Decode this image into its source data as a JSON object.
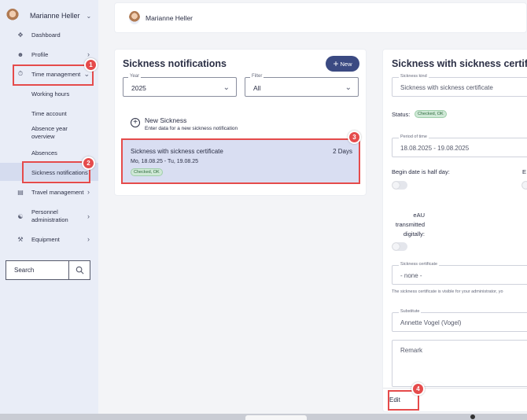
{
  "user": {
    "name": "Marianne Heller"
  },
  "sidebar": {
    "items": [
      {
        "label": "Dashboard",
        "icon": "dashboard-icon"
      },
      {
        "label": "Profile",
        "icon": "person-icon"
      },
      {
        "label": "Time management",
        "icon": "stopwatch-icon"
      },
      {
        "label": "Travel management",
        "icon": "briefcase-icon"
      },
      {
        "label": "Personnel administration",
        "icon": "people-icon"
      },
      {
        "label": "Equipment",
        "icon": "tools-icon"
      }
    ],
    "time_management_sub": [
      "Working hours",
      "Time account",
      "Absence year overview",
      "Absences",
      "Sickness notifications"
    ],
    "search_label": "Search"
  },
  "list_panel": {
    "title": "Sickness notifications",
    "new_button": "New",
    "year": {
      "label": "Year",
      "value": "2025"
    },
    "filter": {
      "label": "Filter",
      "value": "All"
    },
    "new_sickness": {
      "title": "New Sickness",
      "subtitle": "Enter data for a new sickness notification"
    },
    "entries": [
      {
        "title": "Sickness with sickness certificate",
        "duration": "2 Days",
        "dates": "Mo, 18.08.25 - Tu, 19.08.25",
        "status": "Checked, OK"
      }
    ]
  },
  "detail_panel": {
    "title": "Sickness with sickness certificat",
    "kind": {
      "label": "Sickness kind",
      "value": "Sickness with sickness certificate"
    },
    "status_label": "Status:",
    "status_value": "Checked, OK",
    "period": {
      "label": "Period of time",
      "value": "18.08.2025 - 19.08.2025"
    },
    "begin_half_day": "Begin date is half day:",
    "end_half_day_cut": "E",
    "eau_label": "eAU transmitted digitally:",
    "certificate": {
      "label": "Sickness certificate",
      "value": "- none -"
    },
    "certificate_help": "The sickness certificate is visible for your administrator, yo",
    "substitute": {
      "label": "Substitute",
      "value": "Annette Vogel (Vogel)"
    },
    "remark_placeholder": "Remark",
    "edit_button": "Edit"
  },
  "annotations": [
    "1",
    "2",
    "3",
    "4"
  ],
  "colors": {
    "accent": "#3b4a82",
    "highlight": "#e54b4b",
    "sidebar_bg": "#e9edf7",
    "selected_row": "#d9def2"
  }
}
